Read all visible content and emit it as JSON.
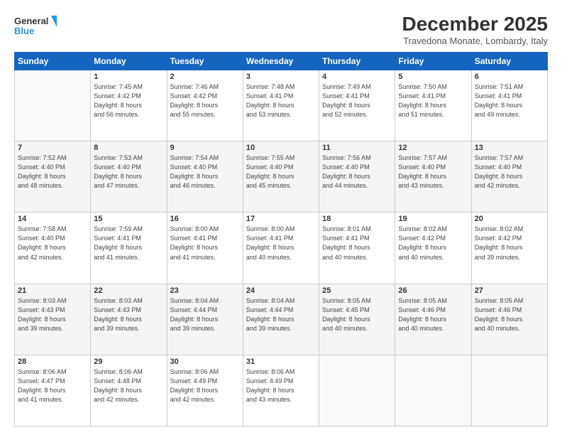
{
  "header": {
    "logo_line1": "General",
    "logo_line2": "Blue",
    "main_title": "December 2025",
    "subtitle": "Travedona Monate, Lombardy, Italy"
  },
  "days_of_week": [
    "Sunday",
    "Monday",
    "Tuesday",
    "Wednesday",
    "Thursday",
    "Friday",
    "Saturday"
  ],
  "weeks": [
    [
      {
        "day": "",
        "info": ""
      },
      {
        "day": "1",
        "info": "Sunrise: 7:45 AM\nSunset: 4:42 PM\nDaylight: 8 hours\nand 56 minutes."
      },
      {
        "day": "2",
        "info": "Sunrise: 7:46 AM\nSunset: 4:42 PM\nDaylight: 8 hours\nand 55 minutes."
      },
      {
        "day": "3",
        "info": "Sunrise: 7:48 AM\nSunset: 4:41 PM\nDaylight: 8 hours\nand 53 minutes."
      },
      {
        "day": "4",
        "info": "Sunrise: 7:49 AM\nSunset: 4:41 PM\nDaylight: 8 hours\nand 52 minutes."
      },
      {
        "day": "5",
        "info": "Sunrise: 7:50 AM\nSunset: 4:41 PM\nDaylight: 8 hours\nand 51 minutes."
      },
      {
        "day": "6",
        "info": "Sunrise: 7:51 AM\nSunset: 4:41 PM\nDaylight: 8 hours\nand 49 minutes."
      }
    ],
    [
      {
        "day": "7",
        "info": "Sunrise: 7:52 AM\nSunset: 4:40 PM\nDaylight: 8 hours\nand 48 minutes."
      },
      {
        "day": "8",
        "info": "Sunrise: 7:53 AM\nSunset: 4:40 PM\nDaylight: 8 hours\nand 47 minutes."
      },
      {
        "day": "9",
        "info": "Sunrise: 7:54 AM\nSunset: 4:40 PM\nDaylight: 8 hours\nand 46 minutes."
      },
      {
        "day": "10",
        "info": "Sunrise: 7:55 AM\nSunset: 4:40 PM\nDaylight: 8 hours\nand 45 minutes."
      },
      {
        "day": "11",
        "info": "Sunrise: 7:56 AM\nSunset: 4:40 PM\nDaylight: 8 hours\nand 44 minutes."
      },
      {
        "day": "12",
        "info": "Sunrise: 7:57 AM\nSunset: 4:40 PM\nDaylight: 8 hours\nand 43 minutes."
      },
      {
        "day": "13",
        "info": "Sunrise: 7:57 AM\nSunset: 4:40 PM\nDaylight: 8 hours\nand 42 minutes."
      }
    ],
    [
      {
        "day": "14",
        "info": "Sunrise: 7:58 AM\nSunset: 4:40 PM\nDaylight: 8 hours\nand 42 minutes."
      },
      {
        "day": "15",
        "info": "Sunrise: 7:59 AM\nSunset: 4:41 PM\nDaylight: 8 hours\nand 41 minutes."
      },
      {
        "day": "16",
        "info": "Sunrise: 8:00 AM\nSunset: 4:41 PM\nDaylight: 8 hours\nand 41 minutes."
      },
      {
        "day": "17",
        "info": "Sunrise: 8:00 AM\nSunset: 4:41 PM\nDaylight: 8 hours\nand 40 minutes."
      },
      {
        "day": "18",
        "info": "Sunrise: 8:01 AM\nSunset: 4:41 PM\nDaylight: 8 hours\nand 40 minutes."
      },
      {
        "day": "19",
        "info": "Sunrise: 8:02 AM\nSunset: 4:42 PM\nDaylight: 8 hours\nand 40 minutes."
      },
      {
        "day": "20",
        "info": "Sunrise: 8:02 AM\nSunset: 4:42 PM\nDaylight: 8 hours\nand 39 minutes."
      }
    ],
    [
      {
        "day": "21",
        "info": "Sunrise: 8:03 AM\nSunset: 4:43 PM\nDaylight: 8 hours\nand 39 minutes."
      },
      {
        "day": "22",
        "info": "Sunrise: 8:03 AM\nSunset: 4:43 PM\nDaylight: 8 hours\nand 39 minutes."
      },
      {
        "day": "23",
        "info": "Sunrise: 8:04 AM\nSunset: 4:44 PM\nDaylight: 8 hours\nand 39 minutes."
      },
      {
        "day": "24",
        "info": "Sunrise: 8:04 AM\nSunset: 4:44 PM\nDaylight: 8 hours\nand 39 minutes."
      },
      {
        "day": "25",
        "info": "Sunrise: 8:05 AM\nSunset: 4:45 PM\nDaylight: 8 hours\nand 40 minutes."
      },
      {
        "day": "26",
        "info": "Sunrise: 8:05 AM\nSunset: 4:46 PM\nDaylight: 8 hours\nand 40 minutes."
      },
      {
        "day": "27",
        "info": "Sunrise: 8:05 AM\nSunset: 4:46 PM\nDaylight: 8 hours\nand 40 minutes."
      }
    ],
    [
      {
        "day": "28",
        "info": "Sunrise: 8:06 AM\nSunset: 4:47 PM\nDaylight: 8 hours\nand 41 minutes."
      },
      {
        "day": "29",
        "info": "Sunrise: 8:06 AM\nSunset: 4:48 PM\nDaylight: 8 hours\nand 42 minutes."
      },
      {
        "day": "30",
        "info": "Sunrise: 8:06 AM\nSunset: 4:49 PM\nDaylight: 8 hours\nand 42 minutes."
      },
      {
        "day": "31",
        "info": "Sunrise: 8:06 AM\nSunset: 4:49 PM\nDaylight: 8 hours\nand 43 minutes."
      },
      {
        "day": "",
        "info": ""
      },
      {
        "day": "",
        "info": ""
      },
      {
        "day": "",
        "info": ""
      }
    ]
  ]
}
